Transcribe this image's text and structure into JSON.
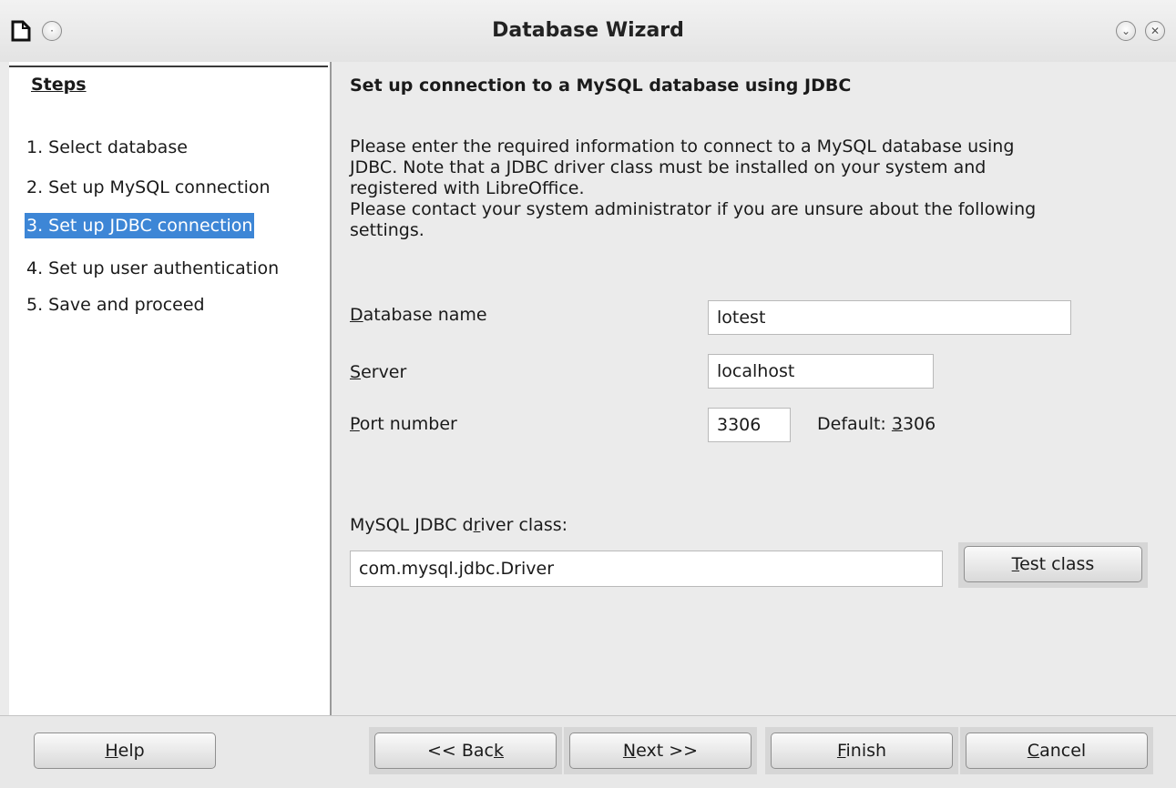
{
  "window": {
    "title": "Database Wizard"
  },
  "steps": {
    "heading": "Steps",
    "items": [
      {
        "label": "1. Select database",
        "selected": false
      },
      {
        "label": "2. Set up MySQL connection",
        "selected": false
      },
      {
        "label": "3. Set up JDBC connection",
        "selected": true
      },
      {
        "label": "4. Set up user authentication",
        "selected": false
      },
      {
        "label": "5. Save and proceed",
        "selected": false
      }
    ]
  },
  "main": {
    "heading": "Set up connection to a MySQL database using JDBC",
    "description": [
      "Please enter the required information to connect to a MySQL database using",
      "JDBC. Note that a JDBC driver class must be installed on your system and",
      "registered with LibreOffice.",
      "Please contact your system administrator if you are unsure about the following",
      "settings."
    ],
    "database_name": {
      "label_mnemonic": "D",
      "label_rest": "atabase name",
      "value": "lotest"
    },
    "server": {
      "label_mnemonic": "S",
      "label_rest": "erver",
      "value": "localhost"
    },
    "port": {
      "label_mnemonic": "P",
      "label_rest": "ort number",
      "value": "3306",
      "default_prefix": "Default: ",
      "default_mnemonic": "3",
      "default_rest": "306"
    },
    "driver": {
      "label_pre": "MySQL JDBC d",
      "label_mnemonic": "r",
      "label_post": "iver class:",
      "value": "com.mysql.jdbc.Driver"
    },
    "test_button": {
      "mnemonic": "T",
      "rest": "est class"
    }
  },
  "buttons": {
    "help": {
      "mnemonic": "H",
      "rest": "elp"
    },
    "back": {
      "pre": "<< Bac",
      "mnemonic": "k"
    },
    "next": {
      "mnemonic": "N",
      "rest": "ext >>"
    },
    "finish": {
      "mnemonic": "F",
      "rest": "inish"
    },
    "cancel": {
      "mnemonic": "C",
      "rest": "ancel"
    }
  },
  "colors": {
    "selection": "#3d86d6",
    "pane_background": "#ffffff",
    "dialog_background": "#ebebeb"
  }
}
